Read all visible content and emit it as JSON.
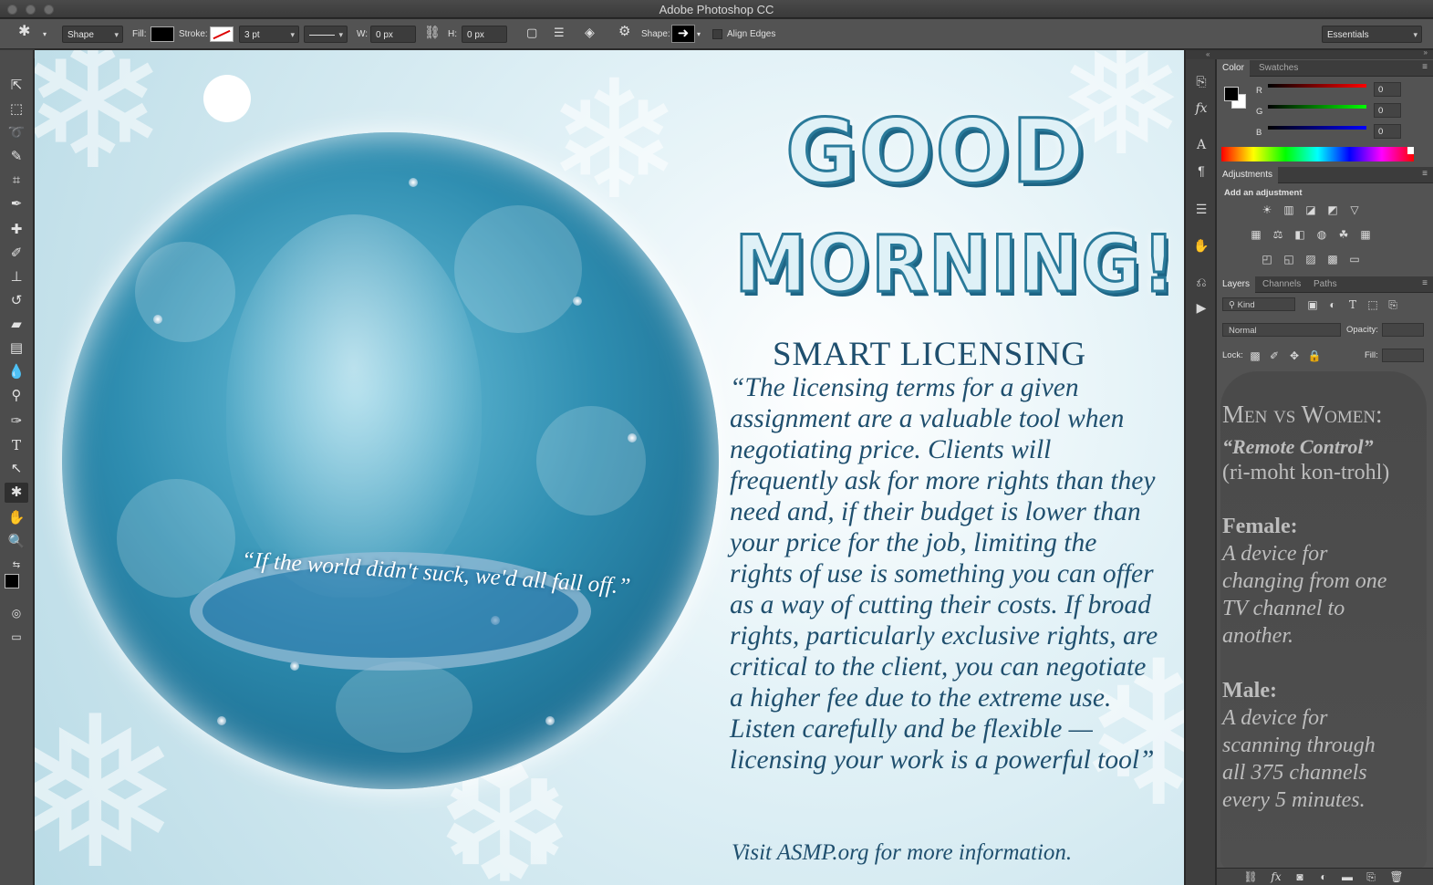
{
  "window": {
    "title": "Adobe Photoshop CC"
  },
  "options_bar": {
    "mode": "Shape",
    "fill_label": "Fill:",
    "stroke_label": "Stroke:",
    "stroke_width": "3 pt",
    "w_label": "W:",
    "w_value": "0 px",
    "h_label": "H:",
    "h_value": "0 px",
    "shape_label": "Shape:",
    "align_edges": "Align Edges",
    "workspace": "Essentials"
  },
  "canvas": {
    "headline_line1": "GOOD",
    "headline_line2": "MORNING!",
    "orb_quote": "“If the world didn't suck, we'd all fall off.”",
    "article_heading": "SMART LICENSING",
    "article_body": "“The licensing terms for a given assignment are a valuable tool when negotiating price. Clients will frequently ask for more rights than they need and, if their budget is lower than your price for the job, limiting the rights of use is something you can offer as a way of cutting their costs. If broad rights, particularly exclusive rights, are critical to the client, you can negotiate a higher fee due to the extreme use. Listen carefully and be flexible — licensing your work is a powerful tool”",
    "article_footer": "Visit ASMP.org for more information."
  },
  "color_panel": {
    "tabs": [
      "Color",
      "Swatches"
    ],
    "r_label": "R",
    "r_value": "0",
    "g_label": "G",
    "g_value": "0",
    "b_label": "B",
    "b_value": "0"
  },
  "adjustments_panel": {
    "tab": "Adjustments",
    "heading": "Add an adjustment"
  },
  "layers_panel": {
    "tabs": [
      "Layers",
      "Channels",
      "Paths"
    ],
    "filter": "Kind",
    "blend_mode": "Normal",
    "opacity_label": "Opacity:",
    "lock_label": "Lock:",
    "fill_label": "Fill:"
  },
  "note": {
    "title": "Men vs Women:",
    "subtitle": "“Remote Control”",
    "pronunciation": "(ri-moht kon-trohl)",
    "female_label": "Female:",
    "female_lines": [
      "A  device for",
      "changing from one",
      "TV channel to",
      "another."
    ],
    "male_label": "Male:",
    "male_lines": [
      "A device  for",
      "scanning through",
      "all 375 channels",
      "every 5 minutes."
    ]
  }
}
